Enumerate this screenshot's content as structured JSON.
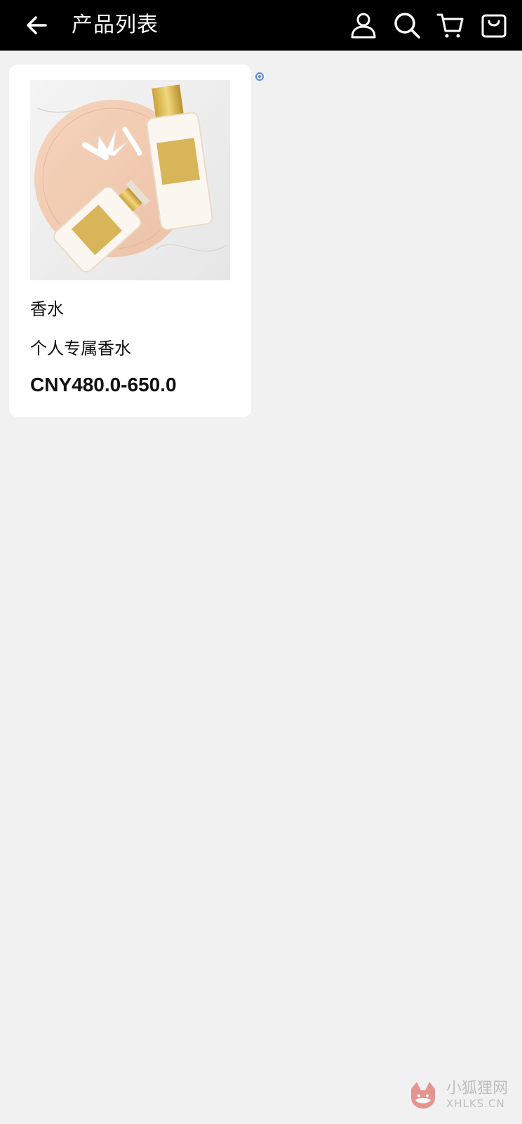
{
  "header": {
    "title": "产品列表",
    "icons": [
      "back-arrow-icon",
      "user-icon",
      "search-icon",
      "cart-icon",
      "shopping-bag-icon"
    ]
  },
  "product": {
    "name": "香水",
    "subtitle": "个人专属香水",
    "price": "CNY480.0-650.0",
    "image_icon": "perfume-product-image"
  },
  "watermark": {
    "text_cn": "小狐狸网",
    "text_en": "XHLKS.CN",
    "logo_icon": "fox-logo-icon"
  },
  "colors": {
    "header_bg": "#000000",
    "page_bg": "#f1f1f1",
    "card_bg": "#ffffff",
    "indicator": "#5a8ad2",
    "watermark_logo": "#e58a88"
  }
}
